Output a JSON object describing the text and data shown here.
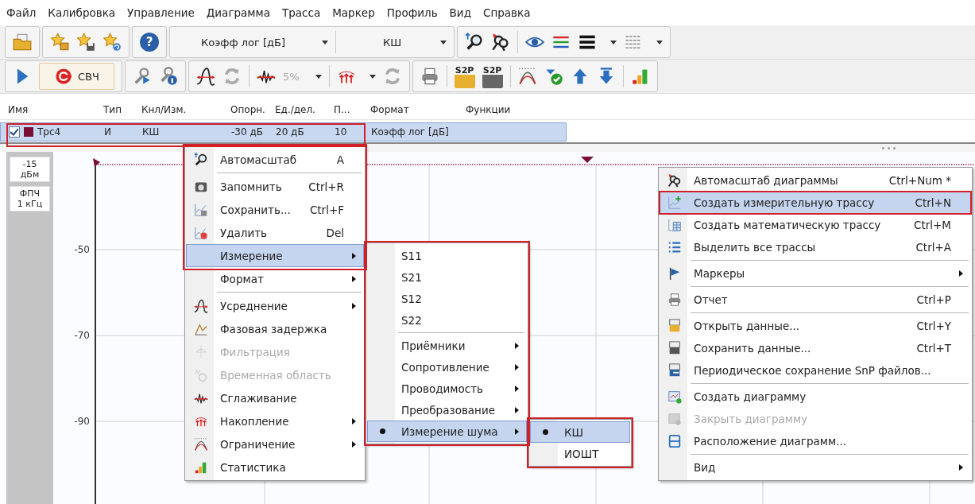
{
  "menu_bar": [
    "Файл",
    "Калибровка",
    "Управление",
    "Диаграмма",
    "Трасса",
    "Маркер",
    "Профиль",
    "Вид",
    "Справка"
  ],
  "toolbar": {
    "help_glyph": "?",
    "format_dropdown": "Коэфф лог [дБ]",
    "measurement_dropdown": "КШ",
    "rf_button": "СВЧ",
    "smoothing_dropdown": {
      "value": "5%",
      "disabled": true
    },
    "data_buttons": [
      "S2P",
      "S2P"
    ]
  },
  "trace_table": {
    "columns": [
      "Имя",
      "Тип",
      "Кнл/Изм.",
      "Опорн.",
      "Ед./дел.",
      "П...",
      "Формат",
      "Функции"
    ],
    "rows": [
      {
        "selected": true,
        "checked": true,
        "color": "#7a0f35",
        "cells": [
          "Трс4",
          "И",
          "КШ",
          "-30 дБ",
          "20 дБ",
          "10",
          "Коэфф лог [дБ]"
        ]
      }
    ]
  },
  "chart": {
    "reference": {
      "value": "-15",
      "unit": "дБм"
    },
    "if_bandwidth": {
      "label": "ФПЧ",
      "value": "1 кГц"
    },
    "y_labels": [
      "-50",
      "-70",
      "-90"
    ]
  },
  "trace_menu": [
    {
      "kind": "item",
      "label": "Автомасштаб",
      "shortcut": "A",
      "submenu": false,
      "selected": false,
      "disabled": false
    },
    {
      "kind": "separator"
    },
    {
      "kind": "item",
      "label": "Запомнить",
      "shortcut": "Ctrl+R",
      "submenu": false,
      "selected": false,
      "disabled": false
    },
    {
      "kind": "item",
      "label": "Сохранить...",
      "shortcut": "Ctrl+F",
      "submenu": false,
      "selected": false,
      "disabled": false
    },
    {
      "kind": "item",
      "label": "Удалить",
      "shortcut": "Del",
      "submenu": false,
      "selected": false,
      "disabled": false
    },
    {
      "kind": "item",
      "label": "Измерение",
      "submenu": true,
      "selected": true,
      "disabled": false
    },
    {
      "kind": "item",
      "label": "Формат",
      "submenu": true,
      "selected": false,
      "disabled": false
    },
    {
      "kind": "separator"
    },
    {
      "kind": "item",
      "label": "Усреднение",
      "submenu": true,
      "selected": false,
      "disabled": false
    },
    {
      "kind": "item",
      "label": "Фазовая задержка",
      "submenu": false,
      "selected": false,
      "disabled": false
    },
    {
      "kind": "item",
      "label": "Фильтрация",
      "submenu": false,
      "selected": false,
      "disabled": true
    },
    {
      "kind": "item",
      "label": "Временная область",
      "submenu": false,
      "selected": false,
      "disabled": true
    },
    {
      "kind": "item",
      "label": "Сглаживание",
      "submenu": false,
      "selected": false,
      "disabled": false
    },
    {
      "kind": "item",
      "label": "Накопление",
      "submenu": true,
      "selected": false,
      "disabled": false
    },
    {
      "kind": "item",
      "label": "Ограничение",
      "submenu": true,
      "selected": false,
      "disabled": false
    },
    {
      "kind": "item",
      "label": "Статистика",
      "submenu": false,
      "selected": false,
      "disabled": false
    }
  ],
  "measurement_submenu": [
    {
      "kind": "item",
      "label": "S11",
      "submenu": false,
      "selected": false,
      "checked": false
    },
    {
      "kind": "item",
      "label": "S21",
      "submenu": false,
      "selected": false,
      "checked": false
    },
    {
      "kind": "item",
      "label": "S12",
      "submenu": false,
      "selected": false,
      "checked": false
    },
    {
      "kind": "item",
      "label": "S22",
      "submenu": false,
      "selected": false,
      "checked": false
    },
    {
      "kind": "separator"
    },
    {
      "kind": "item",
      "label": "Приёмники",
      "submenu": true,
      "selected": false,
      "checked": false
    },
    {
      "kind": "item",
      "label": "Сопротивление",
      "submenu": true,
      "selected": false,
      "checked": false
    },
    {
      "kind": "item",
      "label": "Проводимость",
      "submenu": true,
      "selected": false,
      "checked": false
    },
    {
      "kind": "item",
      "label": "Преобразование",
      "submenu": true,
      "selected": false,
      "checked": false
    },
    {
      "kind": "item",
      "label": "Измерение шума",
      "submenu": true,
      "selected": true,
      "checked": true
    }
  ],
  "noise_submenu": [
    {
      "kind": "item",
      "label": "КШ",
      "submenu": false,
      "selected": true,
      "checked": true
    },
    {
      "kind": "item",
      "label": "ИОШТ",
      "submenu": false,
      "selected": false,
      "checked": false
    }
  ],
  "diagram_menu": [
    {
      "kind": "item",
      "label": "Автомасштаб диаграммы",
      "shortcut": "Ctrl+Num *",
      "submenu": false,
      "selected": false,
      "disabled": false
    },
    {
      "kind": "item",
      "label": "Создать измерительную трассу",
      "shortcut": "Ctrl+N",
      "submenu": false,
      "selected": true,
      "disabled": false
    },
    {
      "kind": "item",
      "label": "Создать математическую трассу",
      "shortcut": "Ctrl+M",
      "submenu": false,
      "selected": false,
      "disabled": false
    },
    {
      "kind": "item",
      "label": "Выделить все трассы",
      "shortcut": "Ctrl+A",
      "submenu": false,
      "selected": false,
      "disabled": false
    },
    {
      "kind": "separator"
    },
    {
      "kind": "item",
      "label": "Маркеры",
      "submenu": true,
      "selected": false,
      "disabled": false
    },
    {
      "kind": "separator"
    },
    {
      "kind": "item",
      "label": "Отчет",
      "shortcut": "Ctrl+P",
      "submenu": false,
      "selected": false,
      "disabled": false
    },
    {
      "kind": "separator"
    },
    {
      "kind": "item",
      "label": "Открыть данные...",
      "shortcut": "Ctrl+Y",
      "submenu": false,
      "selected": false,
      "disabled": false
    },
    {
      "kind": "item",
      "label": "Сохранить данные...",
      "shortcut": "Ctrl+T",
      "submenu": false,
      "selected": false,
      "disabled": false
    },
    {
      "kind": "item",
      "label": "Периодическое сохранение SnP файлов...",
      "submenu": false,
      "selected": false,
      "disabled": false
    },
    {
      "kind": "separator"
    },
    {
      "kind": "item",
      "label": "Создать диаграмму",
      "submenu": false,
      "selected": false,
      "disabled": false
    },
    {
      "kind": "item",
      "label": "Закрыть диаграмму",
      "submenu": false,
      "selected": false,
      "disabled": true
    },
    {
      "kind": "item",
      "label": "Расположение диаграмм...",
      "submenu": false,
      "selected": false,
      "disabled": false
    },
    {
      "kind": "separator"
    },
    {
      "kind": "item",
      "label": "Вид",
      "submenu": true,
      "selected": false,
      "disabled": false
    }
  ]
}
